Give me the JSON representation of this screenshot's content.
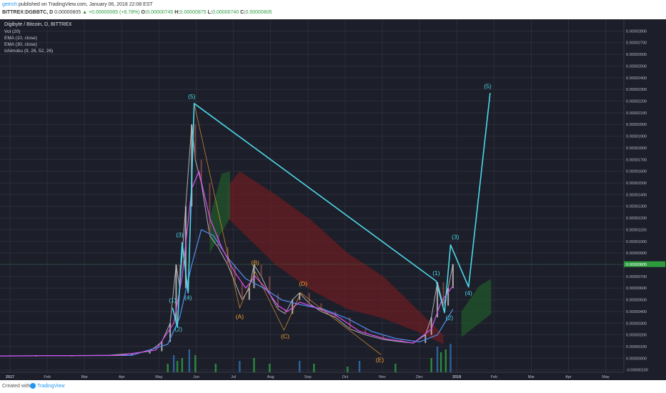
{
  "header": {
    "author": "getrich",
    "published_text": "published on TradingView.com, January 06, 2018 22:08 EST",
    "symbol": "BITTREX:DGBBTC, D",
    "last": "0.00000805",
    "change": "+0.00000065 (+8.78%)",
    "o_label": "O:",
    "o_value": "0.00000745",
    "h_label": "H:",
    "h_value": "0.00000875",
    "l_label": "L:",
    "l_value": "0.00000740",
    "c_label": "C:",
    "c_value": "0.00000805"
  },
  "indicators": {
    "title": "Digibyte / Bitcoin, D, BITTREX",
    "vol": "Vol (20)",
    "ema1": "EMA (10, close)",
    "ema2": "EMA (30, close)",
    "ichimoku": "Ichimoku (9, 26, 52, 26)"
  },
  "footer": {
    "created": "Created with",
    "brand": "TradingView"
  },
  "colors": {
    "background": "#1c1e29",
    "grid": "#2b2e3d",
    "wave": "#4dd8e8",
    "correction": "#f0a030",
    "ema_fast": "#d04fe6",
    "ema_slow": "#4f8be8",
    "cloud_bear": "#7a1a1f",
    "cloud_bull": "#1f5a2a",
    "candle_up": "#c9c9c9",
    "candle_down": "#8b4a4a",
    "last_price_box": "#2e9b3f"
  },
  "chart_data": {
    "type": "line",
    "title": "Digibyte / Bitcoin, D, BITTREX",
    "x_ticks": [
      "2017",
      "Feb",
      "Mar",
      "Apr",
      "May",
      "Jun",
      "Jul",
      "Aug",
      "Sep",
      "Oct",
      "Nov",
      "Dec",
      "2018",
      "Feb",
      "Mar",
      "Apr",
      "May"
    ],
    "y_ticks": [
      "-0.00000100",
      "0.00000000",
      "0.00000100",
      "0.00000200",
      "0.00000300",
      "0.00000400",
      "0.00000500",
      "0.00000600",
      "0.00000700",
      "0.00000800",
      "0.00000900",
      "0.00001000",
      "0.00001100",
      "0.00001200",
      "0.00001300",
      "0.00001400",
      "0.00001500",
      "0.00001600",
      "0.00001700",
      "0.00001800",
      "0.00001900",
      "0.00002000",
      "0.00002100",
      "0.00002200",
      "0.00002300",
      "0.00002400",
      "0.00002500",
      "0.00002600",
      "0.00002700",
      "0.00002800"
    ],
    "ylim": [
      -1.2e-06,
      2.9e-05
    ],
    "last_price_label": "0.00000805",
    "last_price": 8.05e-06,
    "x_range_days": [
      0,
      520
    ],
    "price_series": {
      "name": "DGBBTC close",
      "points": [
        [
          0,
          2e-07
        ],
        [
          30,
          2.1e-07
        ],
        [
          60,
          2.2e-07
        ],
        [
          90,
          2.5e-07
        ],
        [
          110,
          4e-07
        ],
        [
          125,
          6e-07
        ],
        [
          135,
          1.4e-06
        ],
        [
          142,
          3e-06
        ],
        [
          147,
          8e-06
        ],
        [
          150,
          6e-06
        ],
        [
          155,
          1.3e-05
        ],
        [
          160,
          2e-05
        ],
        [
          163,
          1.7e-05
        ],
        [
          168,
          1.5e-05
        ],
        [
          175,
          1.05e-05
        ],
        [
          182,
          9.5e-06
        ],
        [
          190,
          8e-06
        ],
        [
          196,
          6.5e-06
        ],
        [
          202,
          5e-06
        ],
        [
          208,
          6e-06
        ],
        [
          212,
          8e-06
        ],
        [
          218,
          7e-06
        ],
        [
          225,
          5.5e-06
        ],
        [
          232,
          4.2e-06
        ],
        [
          238,
          3.8e-06
        ],
        [
          244,
          5e-06
        ],
        [
          250,
          5.6e-06
        ],
        [
          258,
          4.7e-06
        ],
        [
          268,
          4e-06
        ],
        [
          280,
          3.5e-06
        ],
        [
          292,
          2.5e-06
        ],
        [
          305,
          2e-06
        ],
        [
          320,
          1.6e-06
        ],
        [
          335,
          1.4e-06
        ],
        [
          345,
          1.3e-06
        ],
        [
          355,
          2e-06
        ],
        [
          360,
          3.5e-06
        ],
        [
          365,
          6.5e-06
        ],
        [
          370,
          4.5e-06
        ],
        [
          374,
          6e-06
        ],
        [
          378,
          8.05e-06
        ]
      ]
    },
    "wave_path": {
      "name": "Elliott wave projection",
      "points": [
        [
          144,
          4.3e-06
        ],
        [
          148,
          2.7e-06
        ],
        [
          152,
          9.9e-06
        ],
        [
          157,
          5.6e-06
        ],
        [
          162,
          2.18e-05
        ],
        [
          364,
          6.6e-06
        ],
        [
          371,
          3.9e-06
        ],
        [
          376,
          9.7e-06
        ],
        [
          391,
          6.1e-06
        ],
        [
          409,
          2.27e-05
        ]
      ]
    },
    "correction_path": {
      "name": "ABCDE correction",
      "points": [
        [
          162,
          2.18e-05
        ],
        [
          200,
          4.3e-06
        ],
        [
          213,
          7.4e-06
        ],
        [
          237,
          2.4e-06
        ],
        [
          251,
          5.6e-06
        ],
        [
          318,
          3e-07
        ]
      ]
    },
    "wave_labels": [
      {
        "text": "(1)",
        "x": 144,
        "y": 4.8e-06,
        "series": "impulse1"
      },
      {
        "text": "(2)",
        "x": 149,
        "y": 2.3e-06,
        "series": "impulse1"
      },
      {
        "text": "(3)",
        "x": 150,
        "y": 1.04e-05,
        "series": "impulse1"
      },
      {
        "text": "(4)",
        "x": 157,
        "y": 5e-06,
        "series": "impulse1"
      },
      {
        "text": "(5)",
        "x": 160,
        "y": 2.22e-05,
        "series": "impulse1"
      },
      {
        "text": "(A)",
        "x": 200,
        "y": 3.4e-06,
        "series": "correction"
      },
      {
        "text": "(B)",
        "x": 213,
        "y": 8e-06,
        "series": "correction"
      },
      {
        "text": "(C)",
        "x": 238,
        "y": 1.7e-06,
        "series": "correction"
      },
      {
        "text": "(D)",
        "x": 253,
        "y": 6.2e-06,
        "series": "correction"
      },
      {
        "text": "(E)",
        "x": 317,
        "y": -3e-07,
        "series": "correction"
      },
      {
        "text": "(1)",
        "x": 364,
        "y": 7.1e-06,
        "series": "impulse2"
      },
      {
        "text": "(2)",
        "x": 375,
        "y": 3.3e-06,
        "series": "impulse2"
      },
      {
        "text": "(3)",
        "x": 380,
        "y": 1.02e-05,
        "series": "impulse2"
      },
      {
        "text": "(4)",
        "x": 391,
        "y": 5.4e-06,
        "series": "impulse2"
      },
      {
        "text": "(5)",
        "x": 407,
        "y": 2.31e-05,
        "series": "impulse2"
      }
    ],
    "ema_fast": {
      "name": "EMA (10, close)",
      "points": [
        [
          0,
          2e-07
        ],
        [
          100,
          2.5e-07
        ],
        [
          130,
          7e-07
        ],
        [
          145,
          3e-06
        ],
        [
          152,
          7e-06
        ],
        [
          160,
          1.45e-05
        ],
        [
          166,
          1.6e-05
        ],
        [
          175,
          1.2e-05
        ],
        [
          185,
          9.5e-06
        ],
        [
          195,
          7.5e-06
        ],
        [
          205,
          6e-06
        ],
        [
          213,
          7e-06
        ],
        [
          220,
          6.2e-06
        ],
        [
          232,
          4.5e-06
        ],
        [
          240,
          4e-06
        ],
        [
          250,
          4.8e-06
        ],
        [
          262,
          4.4e-06
        ],
        [
          280,
          3.7e-06
        ],
        [
          300,
          2.3e-06
        ],
        [
          320,
          1.7e-06
        ],
        [
          345,
          1.3e-06
        ],
        [
          360,
          2.5e-06
        ],
        [
          368,
          4.8e-06
        ],
        [
          378,
          6.2e-06
        ]
      ]
    },
    "ema_slow": {
      "name": "EMA (30, close)",
      "points": [
        [
          0,
          2e-07
        ],
        [
          110,
          2.5e-07
        ],
        [
          140,
          1.2e-06
        ],
        [
          150,
          3.5e-06
        ],
        [
          160,
          8e-06
        ],
        [
          168,
          1.1e-05
        ],
        [
          178,
          1.05e-05
        ],
        [
          190,
          8.6e-06
        ],
        [
          205,
          6.8e-06
        ],
        [
          220,
          6e-06
        ],
        [
          235,
          5e-06
        ],
        [
          250,
          4.6e-06
        ],
        [
          270,
          4.2e-06
        ],
        [
          290,
          3.4e-06
        ],
        [
          310,
          2.3e-06
        ],
        [
          330,
          1.7e-06
        ],
        [
          350,
          1.4e-06
        ],
        [
          365,
          2e-06
        ],
        [
          378,
          4.2e-06
        ]
      ]
    },
    "volume": {
      "name": "Vol (20)",
      "days": [
        140,
        145,
        148,
        152,
        158,
        163,
        180,
        200,
        212,
        225,
        250,
        262,
        290,
        300,
        330,
        360,
        365,
        368,
        372,
        376
      ],
      "values": [
        3,
        6,
        4,
        5,
        8,
        6,
        3,
        4,
        5,
        3,
        4,
        3,
        2,
        4,
        3,
        5,
        9,
        7,
        8,
        10
      ]
    },
    "grid": true,
    "legend": "top-left"
  }
}
